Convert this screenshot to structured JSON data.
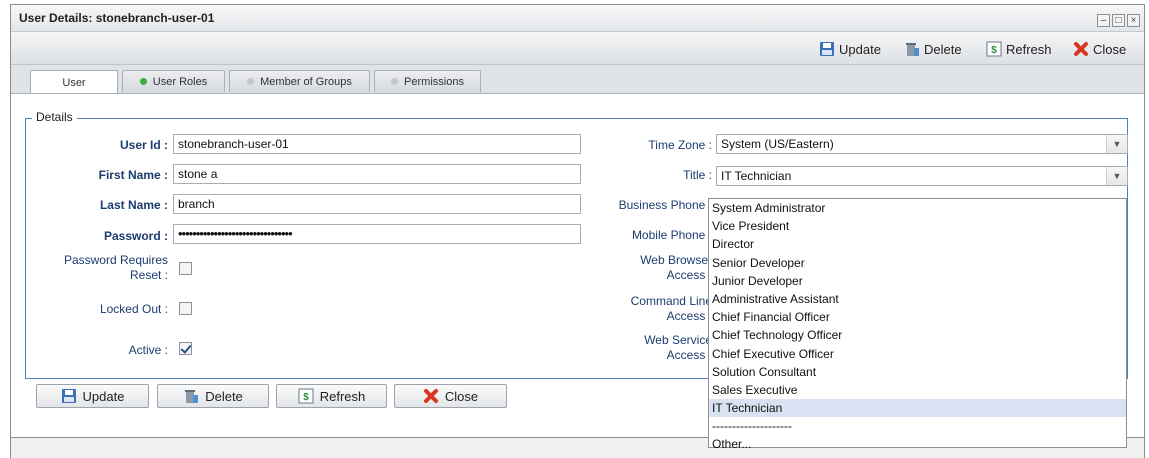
{
  "window": {
    "title": "User Details: stonebranch-user-01"
  },
  "toolbar": {
    "update_label": "Update",
    "delete_label": "Delete",
    "refresh_label": "Refresh",
    "close_label": "Close"
  },
  "tabs": [
    {
      "label": "User"
    },
    {
      "label": "User Roles",
      "dot_color": "#3fae3f"
    },
    {
      "label": "Member of Groups",
      "dot_color": "#c7c7c7"
    },
    {
      "label": "Permissions",
      "dot_color": "#c7c7c7"
    }
  ],
  "details": {
    "legend": "Details",
    "user_id": {
      "label": "User Id :",
      "value": "stonebranch-user-01"
    },
    "first_name": {
      "label": "First Name :",
      "value": "stone a"
    },
    "last_name": {
      "label": "Last Name :",
      "value": "branch"
    },
    "password": {
      "label": "Password :",
      "value": "••••••••••••••••••••••••••••••••"
    },
    "password_reset": {
      "label_line1": "Password Requires",
      "label_line2": "Reset :",
      "checked": false
    },
    "locked_out": {
      "label": "Locked Out :",
      "checked": false
    },
    "active": {
      "label": "Active :",
      "checked": true
    },
    "time_zone": {
      "label": "Time Zone :",
      "value": "System (US/Eastern)"
    },
    "title": {
      "label": "Title :",
      "value": "IT Technician"
    },
    "business_phone": {
      "label": "Business Phone :"
    },
    "mobile_phone": {
      "label": "Mobile Phone :"
    },
    "web_browser": {
      "label_line1": "Web Browser",
      "label_line2": "Access :"
    },
    "command_line": {
      "label_line1": "Command Line",
      "label_line2": "Access :"
    },
    "web_service": {
      "label_line1": "Web Service",
      "label_line2": "Access :"
    }
  },
  "title_options": [
    "System Administrator",
    "Vice President",
    "Director",
    "Senior Developer",
    "Junior Developer",
    "Administrative Assistant",
    "Chief Financial Officer",
    "Chief Technology Officer",
    "Chief Executive Officer",
    "Solution Consultant",
    "Sales Executive",
    "IT Technician",
    "--------------------",
    "Other..."
  ],
  "selected_option": "IT Technician",
  "bottom_buttons": {
    "update_label": "Update",
    "delete_label": "Delete",
    "refresh_label": "Refresh",
    "close_label": "Close"
  },
  "colors": {
    "label_blue": "#1b3d6e",
    "fieldset_border": "#4f7fbd",
    "selected_option_bg": "#d8e2f2",
    "close_red": "#d9361f"
  },
  "window_controls": [
    "minimize-icon",
    "maximize-icon",
    "close-icon"
  ]
}
